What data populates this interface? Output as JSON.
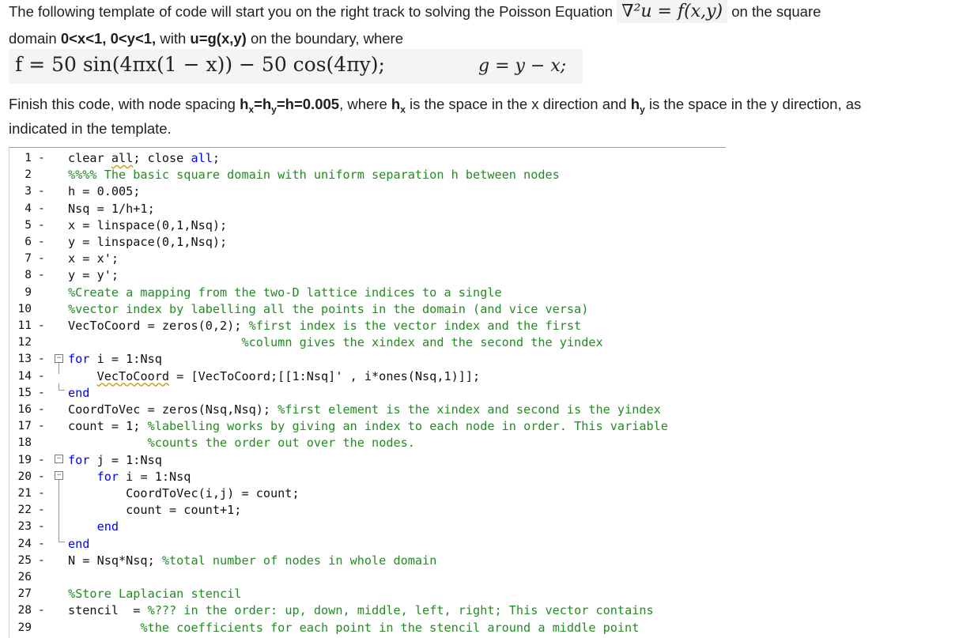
{
  "intro": {
    "line1_a": "The following template of code will start you on the right track to solving the Poisson Equation",
    "line1_math": "∇²u = f(x,y)",
    "line1_b": "on the square",
    "line2_a": "domain ",
    "line2_b": "0<x<1, 0<y<1,",
    "line2_c": " with ",
    "line2_d": "u=g(x,y)",
    "line2_e": " on the boundary, where",
    "f_eq": "f = 50 sin(4πx(1 − x)) − 50 cos(4πy);",
    "g_eq": "g = y − x;",
    "line3_a": "Finish this code, with node spacing ",
    "line3_b": "h",
    "line3_b_sub": "x",
    "line3_c": "=h",
    "line3_c_sub": "y",
    "line3_d": "=h=0.005",
    "line3_e": ", where ",
    "line3_f": "h",
    "line3_f_sub": "x",
    "line3_g": " is the space in the x direction and ",
    "line3_h": "h",
    "line3_h_sub": "y",
    "line3_i": " is the space in the y direction, as",
    "line4": "indicated in the template."
  },
  "code": [
    {
      "n": "1",
      "d": "-",
      "t": [
        [
          "",
          "clear "
        ],
        [
          "w",
          "all"
        ],
        [
          "",
          ";",
          " close "
        ],
        [
          "kw",
          "all"
        ],
        [
          "",
          ";"
        ]
      ]
    },
    {
      "n": "2",
      "d": "",
      "t": [
        [
          "cm",
          "%%%% The basic square domain with uniform separation h between nodes"
        ]
      ]
    },
    {
      "n": "3",
      "d": "-",
      "t": [
        [
          "",
          "h = 0.005;"
        ]
      ]
    },
    {
      "n": "4",
      "d": "-",
      "t": [
        [
          "",
          "Nsq = 1/h+1;"
        ]
      ]
    },
    {
      "n": "5",
      "d": "-",
      "t": [
        [
          "",
          "x = linspace(0,1,Nsq);"
        ]
      ]
    },
    {
      "n": "6",
      "d": "-",
      "t": [
        [
          "",
          "y = linspace(0,1,Nsq);"
        ]
      ]
    },
    {
      "n": "7",
      "d": "-",
      "t": [
        [
          "",
          "x = x';"
        ]
      ]
    },
    {
      "n": "8",
      "d": "-",
      "t": [
        [
          "",
          "y = y';"
        ]
      ]
    },
    {
      "n": "9",
      "d": "",
      "t": [
        [
          "cm",
          "%Create a mapping from the two-D lattice indices to a single"
        ]
      ]
    },
    {
      "n": "10",
      "d": "",
      "t": [
        [
          "cm",
          "%vector index by labelling all the points in the domain (and vice versa)"
        ]
      ]
    },
    {
      "n": "11",
      "d": "-",
      "t": [
        [
          "",
          "VecToCoord = zeros(0,2); "
        ],
        [
          "cm",
          "%first index is the vector index and the first"
        ]
      ]
    },
    {
      "n": "12",
      "d": "",
      "t": [
        [
          "",
          "                        "
        ],
        [
          "cm",
          "%column gives the xindex and the second the yindex"
        ]
      ]
    },
    {
      "n": "13",
      "d": "-",
      "t": [
        [
          "kw",
          "for"
        ],
        [
          "",
          " i = 1:Nsq"
        ]
      ]
    },
    {
      "n": "14",
      "d": "-",
      "t": [
        [
          "",
          "    "
        ],
        [
          "w",
          "VecToCoord"
        ],
        [
          "",
          " = [VecToCoord;[[1:Nsq]' , i*ones(Nsq,1)]];"
        ]
      ]
    },
    {
      "n": "15",
      "d": "-",
      "t": [
        [
          "kw",
          "end"
        ]
      ]
    },
    {
      "n": "16",
      "d": "-",
      "t": [
        [
          "",
          "CoordToVec = zeros(Nsq,Nsq); "
        ],
        [
          "cm",
          "%first element is the xindex and second is the yindex"
        ]
      ]
    },
    {
      "n": "17",
      "d": "-",
      "t": [
        [
          "",
          "count = 1; "
        ],
        [
          "cm",
          "%labelling works by giving an index to each node in order. This variable"
        ]
      ]
    },
    {
      "n": "18",
      "d": "",
      "t": [
        [
          "",
          "           "
        ],
        [
          "cm",
          "%counts the order out over the nodes."
        ]
      ]
    },
    {
      "n": "19",
      "d": "-",
      "t": [
        [
          "kw",
          "for"
        ],
        [
          "",
          " j = 1:Nsq"
        ]
      ]
    },
    {
      "n": "20",
      "d": "-",
      "t": [
        [
          "",
          "    "
        ],
        [
          "kw",
          "for"
        ],
        [
          "",
          " i = 1:Nsq"
        ]
      ]
    },
    {
      "n": "21",
      "d": "-",
      "t": [
        [
          "",
          "        CoordToVec(i,j) = count;"
        ]
      ]
    },
    {
      "n": "22",
      "d": "-",
      "t": [
        [
          "",
          "        count = count+1;"
        ]
      ]
    },
    {
      "n": "23",
      "d": "-",
      "t": [
        [
          "",
          "    "
        ],
        [
          "kw",
          "end"
        ]
      ]
    },
    {
      "n": "24",
      "d": "-",
      "t": [
        [
          "kw",
          "end"
        ]
      ]
    },
    {
      "n": "25",
      "d": "-",
      "t": [
        [
          "",
          "N = Nsq*Nsq; "
        ],
        [
          "cm",
          "%total number of nodes in whole domain"
        ]
      ]
    },
    {
      "n": "26",
      "d": "",
      "t": []
    },
    {
      "n": "27",
      "d": "",
      "t": [
        [
          "cm",
          "%Store Laplacian stencil"
        ]
      ]
    },
    {
      "n": "28",
      "d": "-",
      "t": [
        [
          "",
          "stencil  = "
        ],
        [
          "cm",
          "%??? in the order: up, down, middle, left, right; This vector contains"
        ]
      ]
    },
    {
      "n": "29",
      "d": "",
      "t": [
        [
          "",
          "          "
        ],
        [
          "cm",
          "%the coefficients for each point in the stencil around a middle point"
        ]
      ]
    }
  ]
}
